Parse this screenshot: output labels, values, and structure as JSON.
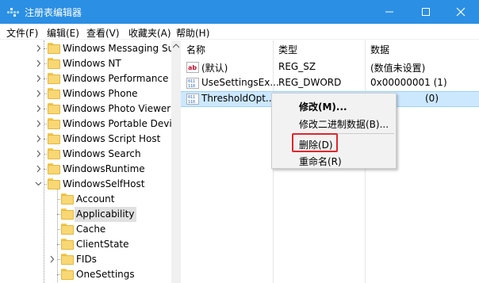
{
  "window": {
    "title": "注册表编辑器",
    "accent_color": "#2b8fe4",
    "controls": [
      "minimize-icon",
      "maximize-icon",
      "close-icon"
    ]
  },
  "menubar": {
    "items": [
      "文件(F)",
      "编辑(E)",
      "查看(V)",
      "收藏夹(A)",
      "帮助(H)"
    ]
  },
  "tree": {
    "items": [
      {
        "label": "Windows Messaging Su",
        "expandable": true
      },
      {
        "label": "Windows NT",
        "expandable": true
      },
      {
        "label": "Windows Performance",
        "expandable": true
      },
      {
        "label": "Windows Phone",
        "expandable": true
      },
      {
        "label": "Windows Photo Viewer",
        "expandable": true
      },
      {
        "label": "Windows Portable Devi",
        "expandable": true
      },
      {
        "label": "Windows Script Host",
        "expandable": true
      },
      {
        "label": "Windows Search",
        "expandable": true
      },
      {
        "label": "WindowsRuntime",
        "expandable": true
      },
      {
        "label": "WindowsSelfHost",
        "expandable": true,
        "expanded": true
      },
      {
        "label": "Account",
        "child": true
      },
      {
        "label": "Applicability",
        "child": true,
        "selected": true
      },
      {
        "label": "Cache",
        "child": true
      },
      {
        "label": "ClientState",
        "child": true
      },
      {
        "label": "FIDs",
        "child": true,
        "expandable": true
      },
      {
        "label": "OneSettings",
        "child": true
      }
    ]
  },
  "list": {
    "headers": [
      "名称",
      "类型",
      "数据"
    ],
    "rows": [
      {
        "icon": "string-value-icon",
        "name": "(默认)",
        "type": "REG_SZ",
        "data": "(数值未设置)"
      },
      {
        "icon": "binary-value-icon",
        "name": "UseSettingsEx...",
        "type": "REG_DWORD",
        "data": "0x00000001 (1)"
      },
      {
        "icon": "binary-value-icon",
        "name": "ThresholdOpt...",
        "type": "",
        "data": "(0)",
        "selected": true
      }
    ]
  },
  "context_menu": {
    "items": [
      "修改(M)...",
      "修改二进制数据(B)...",
      "删除(D)",
      "重命名(R)"
    ],
    "highlight_color": "#e0262c"
  }
}
